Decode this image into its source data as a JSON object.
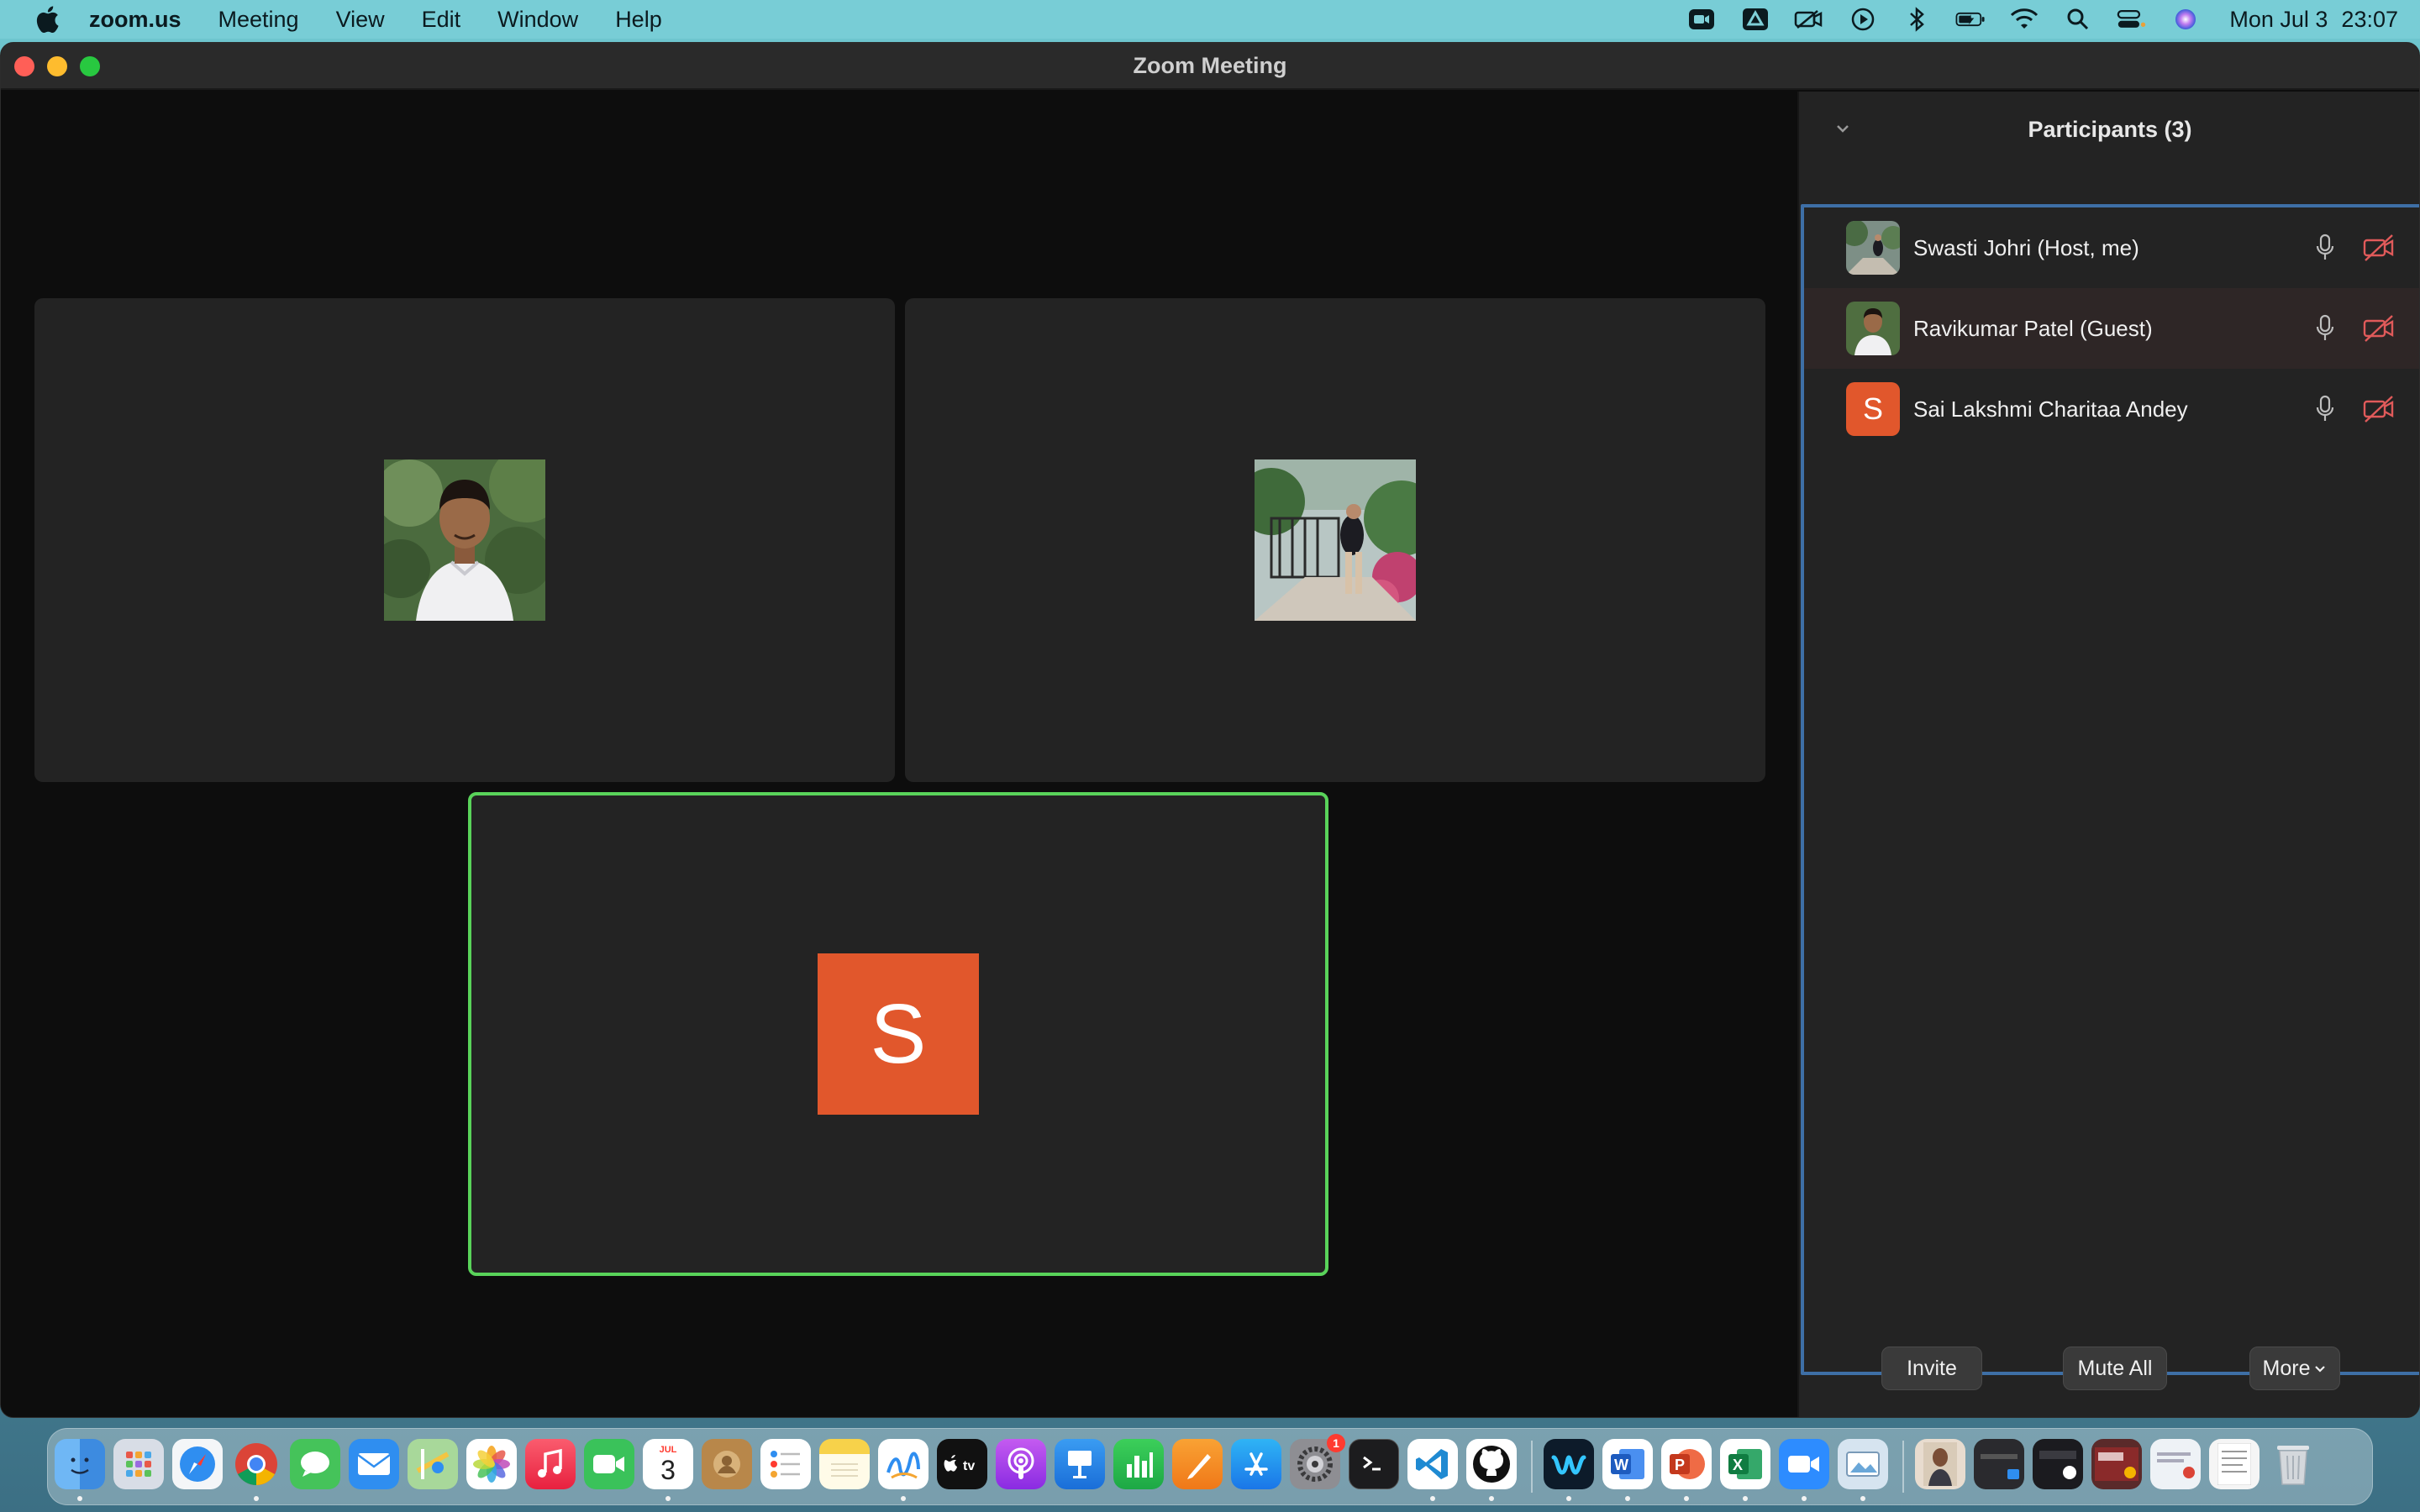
{
  "menubar": {
    "app_name": "zoom.us",
    "menus": [
      "Meeting",
      "View",
      "Edit",
      "Window",
      "Help"
    ],
    "status_icons": [
      "zoom-status-icon",
      "google-drive-icon",
      "screen-mirror-icon",
      "play-icon",
      "bluetooth-icon",
      "battery-charging-icon",
      "wifi-icon",
      "spotlight-search-icon",
      "control-center-icon",
      "siri-icon"
    ],
    "date": "Mon Jul 3",
    "time": "23:07"
  },
  "window": {
    "title": "Zoom Meeting"
  },
  "video_tiles": [
    {
      "participant": "Ravikumar Patel (Guest)",
      "type": "photo",
      "active": false
    },
    {
      "participant": "Swasti Johri (Host, me)",
      "type": "photo",
      "active": false
    },
    {
      "participant": "Sai Lakshmi Charitaa Andey",
      "type": "initial",
      "initial": "S",
      "active": true
    }
  ],
  "participants_panel": {
    "title": "Participants (3)",
    "participants": [
      {
        "name": "Swasti Johri (Host, me)",
        "avatar": "photo",
        "mic": "on",
        "video": "off"
      },
      {
        "name": "Ravikumar Patel (Guest)",
        "avatar": "photo",
        "mic": "on",
        "video": "off"
      },
      {
        "name": "Sai Lakshmi Charitaa Andey",
        "avatar": "initial",
        "initial": "S",
        "mic": "on",
        "video": "off"
      }
    ],
    "footer": {
      "invite_label": "Invite",
      "mute_all_label": "Mute All",
      "more_label": "More"
    }
  },
  "dock": {
    "calendar_month": "JUL",
    "calendar_day": "3",
    "settings_badge": "1",
    "apps": [
      "Finder",
      "Launchpad",
      "Safari",
      "Chrome",
      "Messages",
      "Mail",
      "Maps",
      "Photos",
      "Music",
      "FaceTime",
      "Calendar",
      "Contacts",
      "Reminders",
      "Notes",
      "Freeform",
      "TV",
      "Podcasts",
      "Keynote",
      "Numbers",
      "Pages",
      "App Store",
      "System Settings",
      "Terminal",
      "VS Code",
      "GitHub Desktop",
      "Webex",
      "Word",
      "PowerPoint",
      "Excel",
      "Zoom",
      "Preview",
      "Trash"
    ]
  },
  "colors": {
    "accent_green": "#59d35a",
    "avatar_orange": "#e1572c",
    "panel_border_blue": "#3e6fa6",
    "video_off_red": "#e05a5a"
  }
}
